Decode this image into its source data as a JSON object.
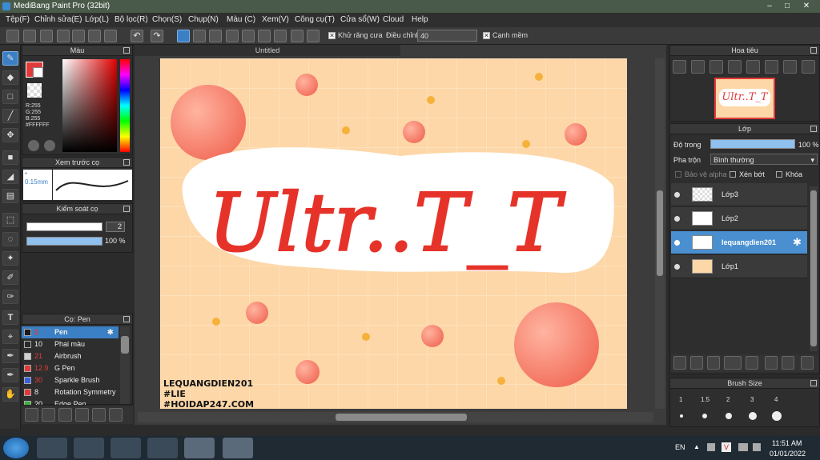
{
  "window": {
    "title": "MediBang Paint Pro (32bit)"
  },
  "menu": [
    "Tệp(F)",
    "Chỉnh sửa(E)",
    "Lớp(L)",
    "Bộ lọc(R)",
    "Chọn(S)",
    "Chụp(N)",
    "Màu (C)",
    "Xem(V)",
    "Công cụ(T)",
    "Cửa sổ(W)",
    "Cloud",
    "Help"
  ],
  "toolbar": {
    "antialias_label": "Khử răng cưa",
    "adjust_label": "Điều chỉnh",
    "adjust_value": "40",
    "snap_label": "Cạnh mềm"
  },
  "color_panel": {
    "title": "Màu",
    "r": "R:255",
    "g": "G:255",
    "b": "B:255",
    "hex": "#FFFFFF"
  },
  "brush_preview": {
    "title": "Xem trước cọ",
    "size": "0.15mm"
  },
  "brush_control": {
    "title": "Kiểm soát cọ",
    "size": "2",
    "opacity": "100 %"
  },
  "brush_list": {
    "title": "Cọ: Pen",
    "items": [
      {
        "size": "2",
        "name": "Pen",
        "color": "#1a1a1a"
      },
      {
        "size": "10",
        "name": "Phai màu",
        "color": "#2a2a2a"
      },
      {
        "size": "21",
        "name": "Airbrush",
        "color": "#cfcfcf"
      },
      {
        "size": "12.9",
        "name": "G Pen",
        "color": "#e23a3a"
      },
      {
        "size": "30",
        "name": "Sparkle Brush",
        "color": "#3a5fe0"
      },
      {
        "size": "8",
        "name": "Rotation Symmetry",
        "color": "#e23a3a"
      },
      {
        "size": "20",
        "name": "Edge Pen",
        "color": "#3ab03a"
      }
    ]
  },
  "document": {
    "tab": "Untitled",
    "artwork_text": "Ultr..T_T",
    "signature": [
      "LEQUANGDIEN201",
      "#LIE",
      "#HOIDAP247.COM"
    ]
  },
  "navigator": {
    "title": "Hoa tiêu"
  },
  "layers": {
    "title": "Lớp",
    "opacity_label": "Độ trong",
    "opacity_value": "100 %",
    "opacity": 1.0,
    "blend_label": "Pha trộn",
    "blend_value": "Bình thường",
    "protect_alpha": "Bảo vệ alpha",
    "clipping": "Xén bớt",
    "lock": "Khóa",
    "items": [
      {
        "name": "Lớp3"
      },
      {
        "name": "Lớp2"
      },
      {
        "name": "lequangdien201"
      },
      {
        "name": "Lớp1"
      }
    ]
  },
  "brush_size": {
    "title": "Brush Size",
    "sizes": [
      "1",
      "1.5",
      "2",
      "3",
      "4"
    ]
  },
  "taskbar": {
    "lang": "EN",
    "time": "11:51 AM",
    "date": "01/01/2022"
  },
  "colors": {
    "accent": "#3b7fc4",
    "canvas": "#fdd7a8",
    "stroke": "#e6332a"
  }
}
